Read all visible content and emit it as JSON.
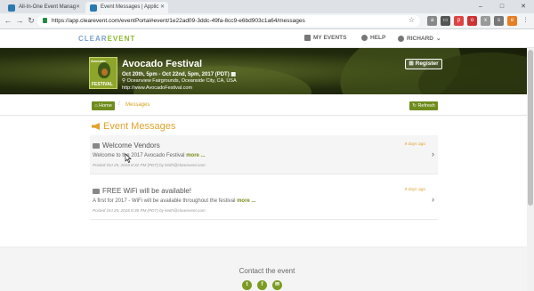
{
  "browser": {
    "tabs": [
      {
        "label": "All-In-One Event Manag"
      },
      {
        "label": "Event Messages | Applic"
      }
    ],
    "url": "https://app.clearevent.com/eventPortal#event/1e22ad09-3ddc-49fa-8cc9-e6bd903c1a64/messages"
  },
  "header": {
    "logo_left": "CLEAR",
    "logo_right": "EVENT",
    "nav": {
      "my_events": "MY EVENTS",
      "help": "HELP",
      "user": "RICHARD"
    }
  },
  "event": {
    "title": "Avocado Festival",
    "dates": "Oct 20th, 5pm - Oct 22nd, 5pm, 2017 (PDT)",
    "venue": "Oceanview Fairgrounds, Oceanside City, CA, USA",
    "website": "http://www.AvocadoFestival.com",
    "register_label": "Register",
    "logo_text_top": "Avocado",
    "logo_text_bottom": "FESTIVAL"
  },
  "breadcrumb": {
    "home": "Home",
    "current": "Messages",
    "refresh": "Refresh"
  },
  "main": {
    "title": "Event Messages",
    "messages": [
      {
        "subject": "Welcome Vendors",
        "body": "Welcome to the 2017 Avocado Festival",
        "more": "more ...",
        "posted": "Posted Oct 25, 2016 8:32 PM (PDT) by keith@clearevent.com",
        "ago": "9 days ago"
      },
      {
        "subject": "FREE WiFi will be available!",
        "body": "A first for 2017 - WiFi will be available throughout the festival",
        "more": "more ...",
        "posted": "Posted Oct 25, 2016 8:36 PM (PDT) by keith@clearevent.com",
        "ago": "9 days ago"
      }
    ]
  },
  "footer": {
    "contact": "Contact the event"
  },
  "colors": {
    "accent_green": "#6f8c1d",
    "accent_orange": "#e0a32e"
  }
}
